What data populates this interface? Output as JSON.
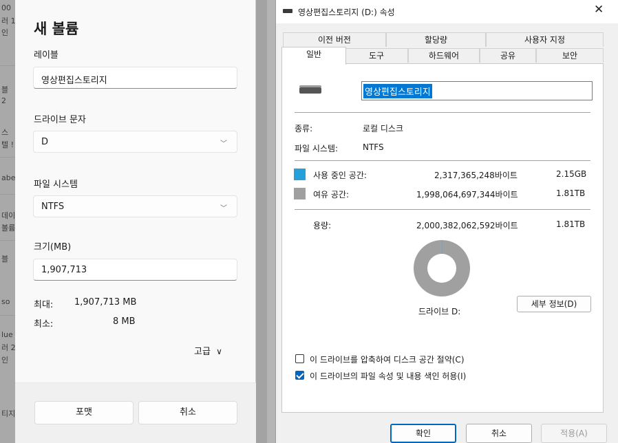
{
  "background_window": {
    "fragments": [
      "00",
      "러 1",
      "인",
      "블",
      "2",
      "스",
      "텔 !",
      "abe",
      "데이",
      "볼륨",
      "블",
      "so",
      "lue",
      "러 2",
      "인",
      "티지"
    ]
  },
  "new_volume": {
    "title": "새 볼륨",
    "label_caption": "레이블",
    "label_value": "영상편집스토리지",
    "drive_letter_caption": "드라이브 문자",
    "drive_letter_value": "D",
    "filesystem_caption": "파일 시스템",
    "filesystem_value": "NTFS",
    "size_caption": "크기(MB)",
    "size_value": "1,907,713",
    "max_caption": "최대:",
    "max_value": "1,907,713 MB",
    "min_caption": "최소:",
    "min_value": "8 MB",
    "advanced_label": "고급",
    "format_button": "포맷",
    "cancel_button": "취소"
  },
  "properties": {
    "window_title": "영상편집스토리지 (D:) 속성",
    "close_glyph": "✕",
    "tabs_row1": [
      "이전 버전",
      "할당량",
      "사용자 지정"
    ],
    "tabs_row2": [
      "일반",
      "도구",
      "하드웨어",
      "공유",
      "보안"
    ],
    "selected_tab": "일반",
    "volume_name": "영상편집스토리지",
    "type_caption": "종류:",
    "type_value": "로컬 디스크",
    "fs_caption": "파일 시스템:",
    "fs_value": "NTFS",
    "used_caption": "사용 중인 공간:",
    "used_bytes": "2,317,365,248바이트",
    "used_short": "2.15GB",
    "free_caption": "여유 공간:",
    "free_bytes": "1,998,064,697,344바이트",
    "free_short": "1.81TB",
    "capacity_caption": "용량:",
    "capacity_bytes": "2,000,382,062,592바이트",
    "capacity_short": "1.81TB",
    "drive_caption": "드라이브 D:",
    "details_button": "세부 정보(D)",
    "compress_label": "이 드라이브를 압축하여 디스크 공간 절약(C)",
    "compress_checked": false,
    "index_label": "이 드라이브의 파일 속성 및 내용 색인 허용(I)",
    "index_checked": true,
    "ok_button": "확인",
    "cancel_button": "취소",
    "apply_button": "적용(A)",
    "used_fraction": 0.00116
  },
  "colors": {
    "used_space": "#26a0da",
    "free_space": "#a0a0a0",
    "accent": "#0067c0"
  },
  "icons": {
    "drive": "hard-drive-icon",
    "window": "drive-window-icon",
    "close": "close-icon",
    "chevron": "chevron-down-icon"
  }
}
